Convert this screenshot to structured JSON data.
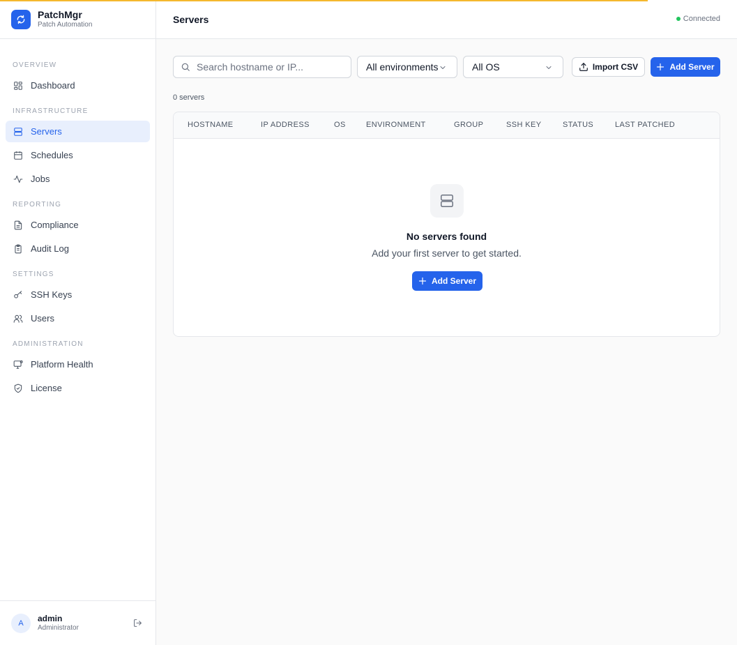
{
  "app": {
    "name": "PatchMgr",
    "subtitle": "Patch Automation"
  },
  "sidebar": {
    "sections": [
      {
        "title": "OVERVIEW",
        "items": [
          {
            "label": "Dashboard",
            "icon": "dashboard-icon"
          }
        ]
      },
      {
        "title": "INFRASTRUCTURE",
        "items": [
          {
            "label": "Servers",
            "icon": "server-icon",
            "active": true
          },
          {
            "label": "Schedules",
            "icon": "calendar-icon"
          },
          {
            "label": "Jobs",
            "icon": "activity-icon"
          }
        ]
      },
      {
        "title": "REPORTING",
        "items": [
          {
            "label": "Compliance",
            "icon": "document-icon"
          },
          {
            "label": "Audit Log",
            "icon": "clipboard-icon"
          }
        ]
      },
      {
        "title": "SETTINGS",
        "items": [
          {
            "label": "SSH Keys",
            "icon": "key-icon"
          },
          {
            "label": "Users",
            "icon": "users-icon"
          }
        ]
      },
      {
        "title": "ADMINISTRATION",
        "items": [
          {
            "label": "Platform Health",
            "icon": "monitor-icon"
          },
          {
            "label": "License",
            "icon": "shield-icon"
          }
        ]
      }
    ]
  },
  "user": {
    "initial": "A",
    "name": "admin",
    "role": "Administrator"
  },
  "header": {
    "title": "Servers",
    "status": "Connected",
    "status_color": "#22c55e"
  },
  "toolbar": {
    "search_placeholder": "Search hostname or IP...",
    "environment_filter": "All environments",
    "os_filter": "All OS",
    "import_label": "Import CSV",
    "add_label": "Add Server"
  },
  "table": {
    "count_text": "0 servers",
    "columns": [
      "HOSTNAME",
      "IP ADDRESS",
      "OS",
      "ENVIRONMENT",
      "GROUP",
      "SSH KEY",
      "STATUS",
      "LAST PATCHED"
    ]
  },
  "empty_state": {
    "title": "No servers found",
    "subtitle": "Add your first server to get started.",
    "button_label": "Add Server"
  },
  "colors": {
    "accent": "#2563eb",
    "progress_bar": "#f5b82e"
  }
}
